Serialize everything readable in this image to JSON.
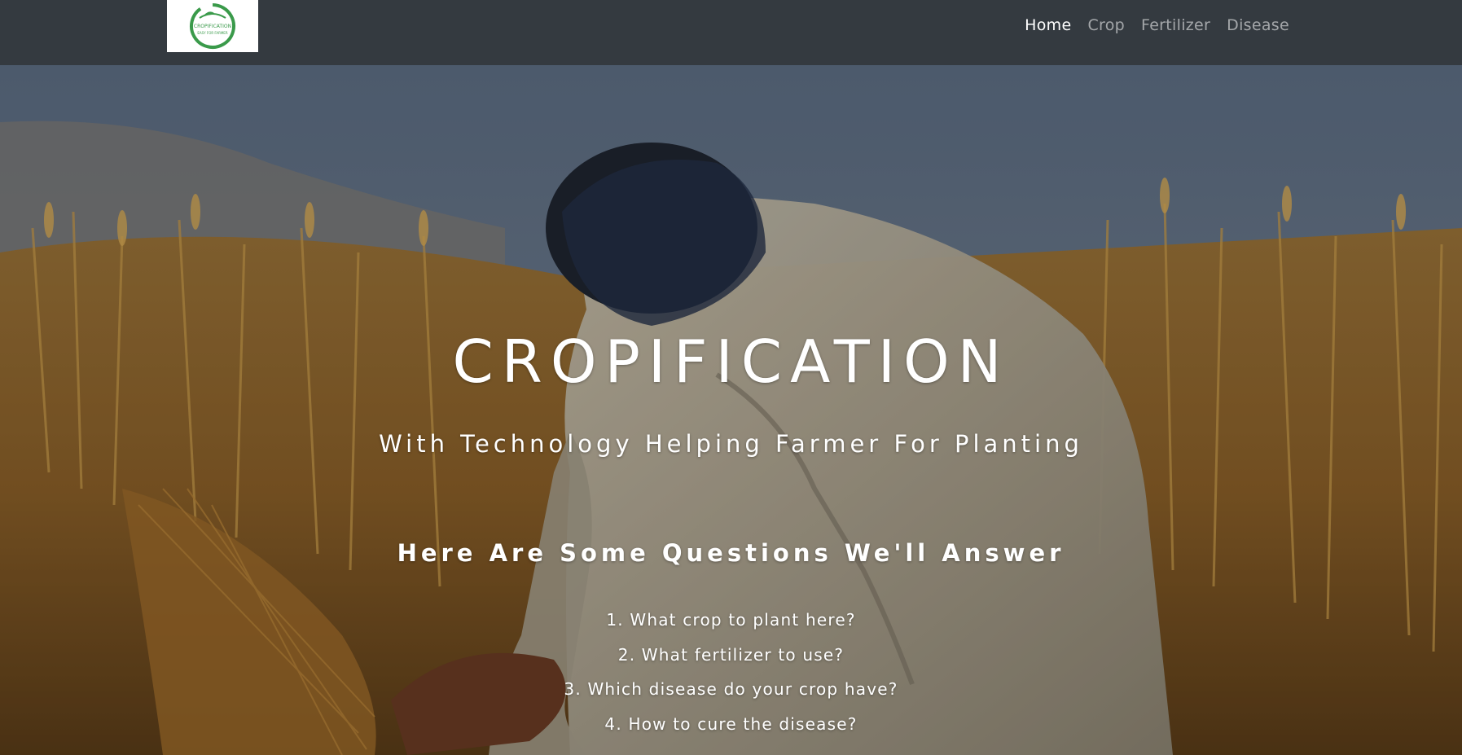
{
  "navbar": {
    "logo": {
      "name": "cropification-logo",
      "text_top": "CROPIFICATION",
      "text_bottom": "EASY FOR FARMER",
      "color": "#3a9a4a"
    },
    "links": [
      {
        "label": "Home",
        "active": true
      },
      {
        "label": "Crop",
        "active": false
      },
      {
        "label": "Fertilizer",
        "active": false
      },
      {
        "label": "Disease",
        "active": false
      }
    ]
  },
  "hero": {
    "title": "CROPIFICATION",
    "subtitle": "With Technology Helping Farmer For Planting",
    "questions_heading": "Here Are Some Questions We'll Answer",
    "questions": [
      "1. What crop to plant here?",
      "2. What fertilizer to use?",
      "3. Which disease do your crop have?",
      "4. How to cure the disease?"
    ],
    "background": "farmer-harvesting-wheat-photo"
  },
  "colors": {
    "navbar_bg": "#343a40",
    "nav_active": "#ffffff",
    "nav_inactive": "rgba(255,255,255,0.55)",
    "hero_text": "#ffffff"
  }
}
